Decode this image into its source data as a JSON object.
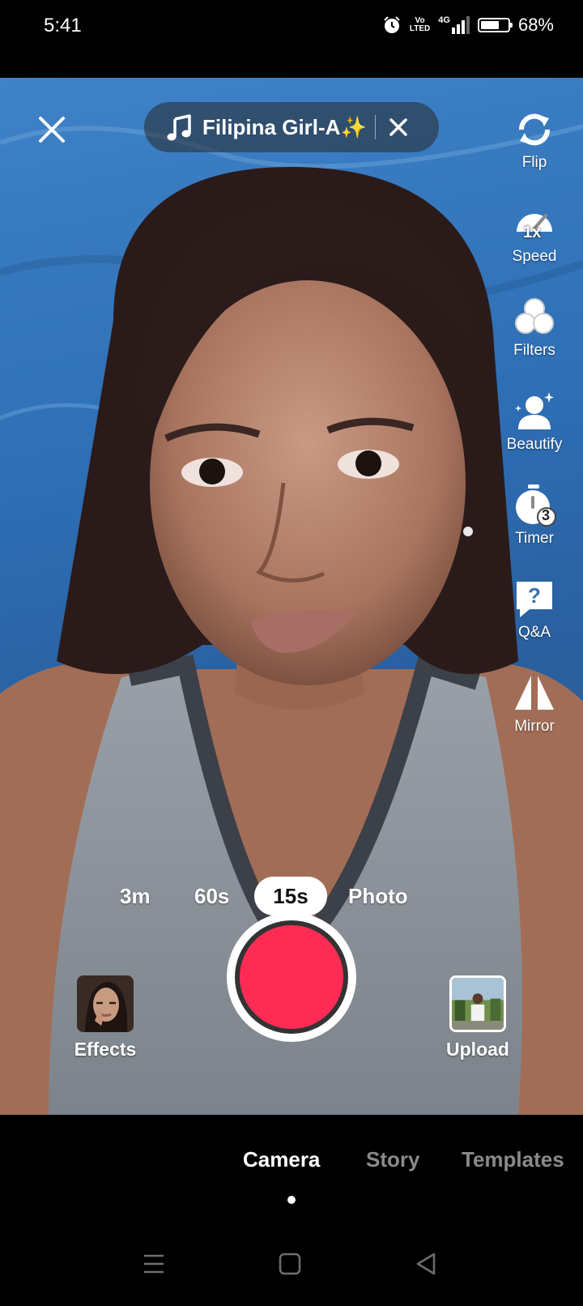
{
  "status_bar": {
    "time": "5:41",
    "network_top": "Vo",
    "network_bottom": "LTED",
    "signal_label": "4G",
    "battery": "68%",
    "battery_level": 0.68
  },
  "top_bar": {
    "sound_title": "Filipina Girl-A✨"
  },
  "toolbar": {
    "flip": "Flip",
    "speed": "Speed",
    "speed_value": "1x",
    "filters": "Filters",
    "beautify": "Beautify",
    "timer": "Timer",
    "timer_value": "3",
    "qa": "Q&A",
    "mirror": "Mirror"
  },
  "durations": {
    "items": [
      "3m",
      "60s",
      "15s",
      "Photo"
    ],
    "selected": "15s"
  },
  "controls": {
    "effects": "Effects",
    "upload": "Upload"
  },
  "modes": {
    "items": [
      "Camera",
      "Story",
      "Templates"
    ],
    "selected": "Camera"
  },
  "colors": {
    "record": "#fe2c55",
    "inactive_tab": "#8a8a8a"
  }
}
